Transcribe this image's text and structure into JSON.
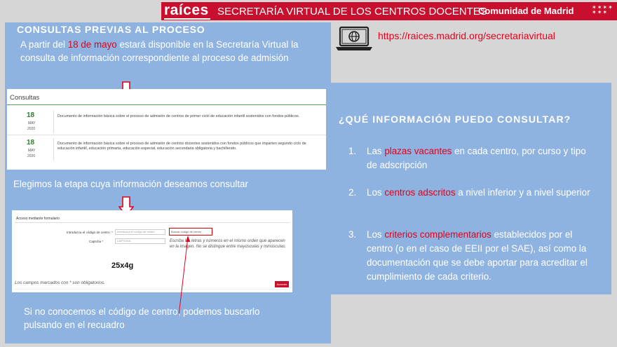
{
  "header": {
    "logo": "raíces",
    "subtitle": "SECRETARÍA VIRTUAL DE LOS CENTROS DOCENTES",
    "region": "Comunidad de Madrid",
    "stars": "✶✶✶✶ ✶✶✶"
  },
  "left": {
    "title": "CONSULTAS PREVIAS AL PROCESO",
    "intro_pre": "A partir del ",
    "intro_highlight": "18 de mayo",
    "intro_post": " estará disponible en la Secretaría Virtual  la consulta de información correspondiente al proceso de admisión",
    "consultas": {
      "heading": "Consultas",
      "rows": [
        {
          "day": "18",
          "month": "MAY",
          "year": "2020",
          "text": "Documento de información básica sobre el proceso de admisión de centros de primer ciclo de educación infantil sostenidos con fondos públicos."
        },
        {
          "day": "18",
          "month": "MAY",
          "year": "2020",
          "text": "Documento de información básica sobre el proceso de admisión de centros docentes sostenidos con fondos públicos que imparten segundo ciclo de educación infantil, educación primaria, educación especial, educación secundaria obligatoria y bachillerato."
        }
      ]
    },
    "elegimos": "Elegimos  la etapa cuya información deseamos consultar",
    "form": {
      "title": "Acceso mediante formulario",
      "code_label": "Introduzca el código de centro: *",
      "code_placeholder": "Introduzca el código de centro",
      "search_button": "Buscar código de centro",
      "captcha_label": "Captcha *",
      "captcha_placeholder": "CAPTCHA",
      "captcha_note": "Escriba las letras y números en el mismo orden que aparecen en la imagen. No se distingue entre mayúsculas y minúsculas.",
      "captcha_text": "25x4g",
      "required_note": "Los campos marcados con * son obligatorios.",
      "submit": "Acceder"
    },
    "bottom_text": "Si no conocemos el código de centro, podemos buscarlo pulsando en el recuadro"
  },
  "url": "https://raices.madrid.org/secretariavirtual",
  "right": {
    "title": "¿QUÉ INFORMACIÓN PUEDO CONSULTAR?",
    "items": [
      {
        "num": "1.",
        "pre": "Las ",
        "hl": "plazas vacantes",
        "post": " en cada centro, por curso y tipo de adscripción"
      },
      {
        "num": "2.",
        "pre": "Los ",
        "hl": "centros adscritos",
        "post": " a nivel inferior y a nivel superior"
      },
      {
        "num": "3.",
        "pre": "Los ",
        "hl": "criterios complementarios",
        "post": " establecidos por el centro (o en el caso de EEII por el SAE), así como la documentación que se debe aportar para acreditar el cumplimiento de cada criterio."
      }
    ]
  },
  "colors": {
    "accent_red": "#e3001b",
    "header_red": "#c8102e",
    "panel_blue": "#8fb3e0"
  },
  "icons": [
    "laptop-globe-icon",
    "down-arrow-icon"
  ]
}
